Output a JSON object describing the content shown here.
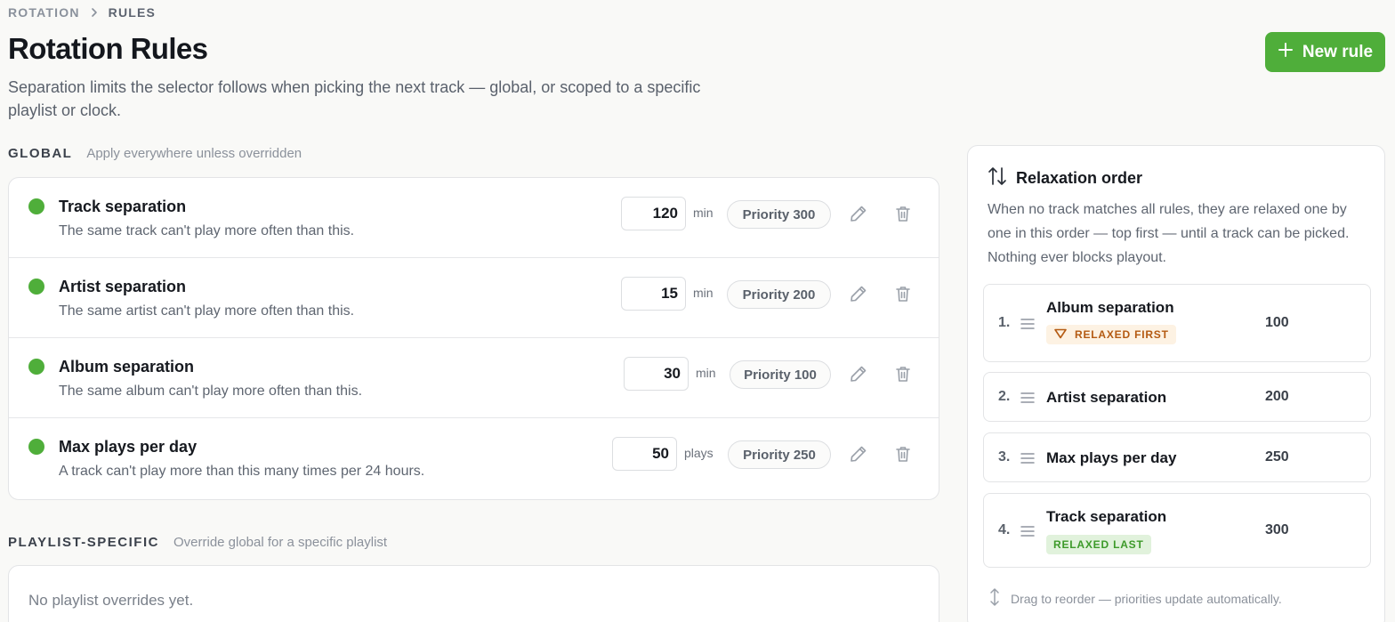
{
  "breadcrumb": {
    "parent": "ROTATION",
    "current": "RULES"
  },
  "page": {
    "title": "Rotation Rules",
    "subtitle": "Separation limits the selector follows when picking the next track — global, or scoped to a specific playlist or clock.",
    "new_rule_label": "New rule"
  },
  "global": {
    "label": "GLOBAL",
    "description": "Apply everywhere unless overridden",
    "rules": [
      {
        "name": "Track separation",
        "description": "The same track can't play more often than this.",
        "value": "120",
        "unit": "min",
        "priority": "Priority 300"
      },
      {
        "name": "Artist separation",
        "description": "The same artist can't play more often than this.",
        "value": "15",
        "unit": "min",
        "priority": "Priority 200"
      },
      {
        "name": "Album separation",
        "description": "The same album can't play more often than this.",
        "value": "30",
        "unit": "min",
        "priority": "Priority 100"
      },
      {
        "name": "Max plays per day",
        "description": "A track can't play more than this many times per 24 hours.",
        "value": "50",
        "unit": "plays",
        "priority": "Priority 250"
      }
    ]
  },
  "playlist": {
    "label": "PLAYLIST-SPECIFIC",
    "description": "Override global for a specific playlist",
    "empty_text": "No playlist overrides yet."
  },
  "relaxation": {
    "title": "Relaxation order",
    "description": "When no track matches all rules, they are relaxed one by one in this order — top first — until a track can be picked. Nothing ever blocks playout.",
    "items": [
      {
        "num": "1.",
        "name": "Album separation",
        "value": "100",
        "badge": "RELAXED FIRST"
      },
      {
        "num": "2.",
        "name": "Artist separation",
        "value": "200"
      },
      {
        "num": "3.",
        "name": "Max plays per day",
        "value": "250"
      },
      {
        "num": "4.",
        "name": "Track separation",
        "value": "300",
        "badge": "RELAXED LAST"
      }
    ],
    "footer": "Drag to reorder — priorities update automatically."
  },
  "colors": {
    "accent": "#4fae3a",
    "badge_first": "#b45a12",
    "badge_last": "#3d9a2a"
  },
  "icons": [
    "chevron-right-icon",
    "plus-icon",
    "status-dot-icon",
    "pencil-icon",
    "trash-icon",
    "sort-arrows-icon",
    "drag-handle-icon",
    "triangle-down-icon",
    "vertical-arrows-icon"
  ]
}
